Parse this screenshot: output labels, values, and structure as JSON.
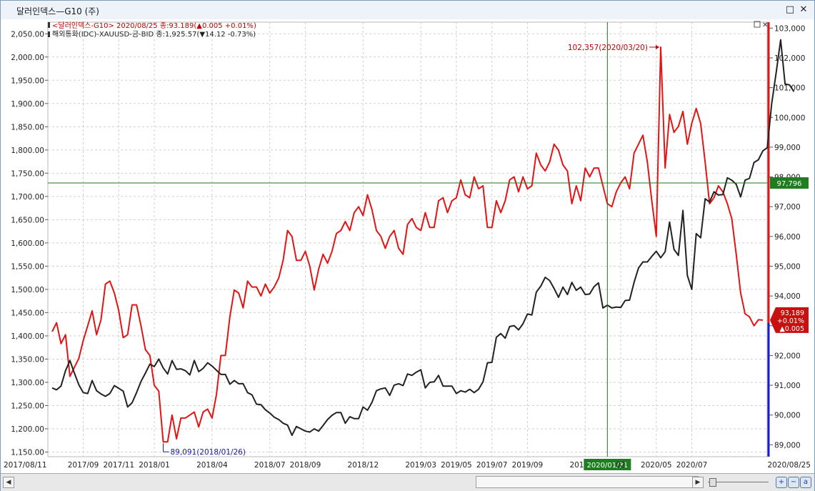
{
  "window": {
    "title": "달러인덱스—G10 (주)",
    "restore_glyph": "□",
    "close_glyph": "✕"
  },
  "legend": {
    "series1": "<달러인덱스-G10> 2020/08/25 종:93.189(▲0.005 +0.01%)",
    "series2": "해외통화(IDC)-XAUUSD-금-BID 종:1,925.57(▼14.12 -0.73%)"
  },
  "annotations": {
    "max_label": "102,357(2020/03/20)",
    "min_label": "89,091(2018/01/26)",
    "crosshair_x_label": "2020/01/31",
    "crosshair_y_label": "97,796",
    "last_value_lines": [
      "93,189",
      "+0.01%",
      "▲0.005"
    ]
  },
  "colors": {
    "dollar_index": "#e21414",
    "gold": "#222222",
    "crosshair": "#1e7d1e",
    "grid": "#cfcfcf",
    "right_axis_bar": "#e21414",
    "right_axis_bar_lower": "#1a1ad8",
    "label_red": "#c00000",
    "label_blue": "#1a1aa0"
  },
  "chart_data": {
    "type": "line",
    "left_axis": {
      "series": "gold",
      "ylim": [
        1140,
        2075
      ],
      "ticks": [
        1150,
        1200,
        1250,
        1300,
        1350,
        1400,
        1450,
        1500,
        1550,
        1600,
        1650,
        1700,
        1750,
        1800,
        1850,
        1900,
        1950,
        2000,
        2050
      ],
      "tick_labels": [
        "1,150.00",
        "1,200.00",
        "1,250.00",
        "1,300.00",
        "1,350.00",
        "1,400.00",
        "1,450.00",
        "1,500.00",
        "1,550.00",
        "1,600.00",
        "1,650.00",
        "1,700.00",
        "1,750.00",
        "1,800.00",
        "1,850.00",
        "1,900.00",
        "1,950.00",
        "2,000.00",
        "2,050.00"
      ]
    },
    "right_axis": {
      "series": "dollar_index",
      "ylim": [
        88.6,
        103.2
      ],
      "ticks": [
        89,
        90,
        91,
        92,
        93,
        94,
        95,
        96,
        97,
        98,
        99,
        100,
        101,
        102,
        103
      ],
      "tick_labels": [
        "89,000",
        "90,000",
        "91,000",
        "92,000",
        "93,000",
        "94,000",
        "95,000",
        "96,000",
        "97,000",
        "98,000",
        "99,000",
        "100,000",
        "101,000",
        "102,000",
        "103,000"
      ]
    },
    "x_axis": {
      "labels": [
        "2017/08/11",
        "2017/09",
        "2017/11",
        "2018/01",
        "2018/04",
        "2018/07",
        "2018/09",
        "2018/12",
        "2019/03",
        "2019/05",
        "2019/07",
        "2019/09",
        "2019/12",
        "2020/01/31",
        "02",
        "2020/05",
        "2020/07",
        "2020/08/25"
      ],
      "label_index": [
        0,
        7,
        15,
        23,
        36,
        49,
        57,
        70,
        83,
        91,
        99,
        107,
        120,
        125,
        128,
        136,
        144,
        156
      ]
    },
    "crosshair": {
      "index": 125,
      "dollar_index": 97.796
    },
    "series": [
      {
        "name": "<달러인덱스-G10>",
        "key": "dollar_index",
        "axis": "right",
        "values": [
          92.8,
          93.1,
          92.4,
          92.7,
          91.3,
          91.6,
          91.9,
          92.5,
          93.0,
          93.5,
          92.7,
          93.2,
          94.4,
          94.5,
          94.1,
          93.5,
          92.6,
          92.7,
          93.7,
          93.7,
          93.0,
          92.2,
          92.0,
          91.0,
          90.8,
          89.1,
          89.1,
          90.0,
          89.2,
          89.9,
          89.9,
          90.0,
          90.1,
          89.6,
          90.1,
          90.2,
          89.9,
          90.7,
          92.0,
          92.0,
          93.3,
          94.2,
          94.1,
          93.6,
          94.5,
          94.3,
          94.3,
          94.0,
          94.4,
          94.1,
          94.3,
          94.6,
          95.2,
          96.2,
          96.0,
          95.2,
          95.2,
          95.5,
          95.0,
          94.2,
          94.9,
          95.4,
          95.1,
          95.5,
          96.1,
          96.2,
          96.5,
          96.2,
          96.8,
          97.0,
          96.7,
          97.4,
          96.9,
          96.2,
          96.0,
          95.6,
          96.0,
          96.2,
          95.6,
          95.4,
          96.4,
          96.6,
          96.3,
          96.2,
          96.8,
          96.3,
          96.3,
          97.2,
          97.3,
          96.8,
          97.2,
          97.3,
          97.9,
          97.4,
          97.3,
          98.0,
          97.6,
          97.7,
          96.3,
          96.3,
          97.2,
          96.8,
          97.2,
          97.9,
          98.0,
          97.5,
          98.0,
          97.6,
          97.7,
          98.8,
          98.4,
          98.2,
          98.5,
          99.1,
          98.9,
          98.4,
          98.2,
          97.1,
          97.7,
          97.2,
          98.3,
          98.0,
          98.3,
          98.3,
          97.7,
          97.1,
          97.0,
          97.5,
          97.8,
          98.0,
          97.6,
          98.8,
          99.1,
          99.4,
          98.5,
          97.2,
          96.0,
          102.36,
          98.3,
          100.1,
          99.5,
          99.7,
          100.2,
          99.1,
          99.8,
          100.3,
          99.8,
          98.5,
          97.1,
          97.3,
          97.7,
          97.5,
          97.1,
          96.6,
          95.4,
          94.1,
          93.4,
          93.3,
          93.0,
          93.2,
          93.19
        ]
      },
      {
        "name": "해외통화(IDC)-XAUUSD-금-BID",
        "key": "gold",
        "axis": "left",
        "values": [
          1288,
          1284,
          1292,
          1325,
          1347,
          1320,
          1295,
          1278,
          1276,
          1304,
          1282,
          1275,
          1270,
          1276,
          1293,
          1287,
          1281,
          1247,
          1256,
          1278,
          1302,
          1320,
          1339,
          1334,
          1350,
          1331,
          1318,
          1347,
          1328,
          1329,
          1325,
          1316,
          1347,
          1323,
          1330,
          1342,
          1335,
          1326,
          1317,
          1317,
          1296,
          1304,
          1297,
          1297,
          1278,
          1273,
          1253,
          1252,
          1241,
          1234,
          1225,
          1220,
          1212,
          1208,
          1186,
          1205,
          1200,
          1195,
          1193,
          1200,
          1195,
          1207,
          1220,
          1229,
          1235,
          1235,
          1212,
          1226,
          1222,
          1222,
          1247,
          1240,
          1257,
          1282,
          1286,
          1288,
          1272,
          1294,
          1297,
          1293,
          1318,
          1315,
          1322,
          1327,
          1288,
          1300,
          1301,
          1315,
          1292,
          1292,
          1292,
          1276,
          1282,
          1279,
          1285,
          1278,
          1285,
          1301,
          1342,
          1343,
          1397,
          1405,
          1395,
          1420,
          1422,
          1413,
          1426,
          1447,
          1445,
          1494,
          1507,
          1526,
          1519,
          1502,
          1483,
          1505,
          1489,
          1515,
          1498,
          1505,
          1489,
          1490,
          1506,
          1514,
          1460,
          1466,
          1460,
          1462,
          1461,
          1476,
          1477,
          1515,
          1546,
          1559,
          1559,
          1571,
          1582,
          1568,
          1581,
          1645,
          1586,
          1573,
          1670,
          1530,
          1500,
          1620,
          1611,
          1695,
          1688,
          1710,
          1703,
          1704,
          1740,
          1735,
          1726,
          1699,
          1735,
          1739,
          1773,
          1779,
          1798,
          1805,
          1900,
          1967,
          2037,
          1942,
          1940,
          1925.57
        ]
      }
    ]
  }
}
